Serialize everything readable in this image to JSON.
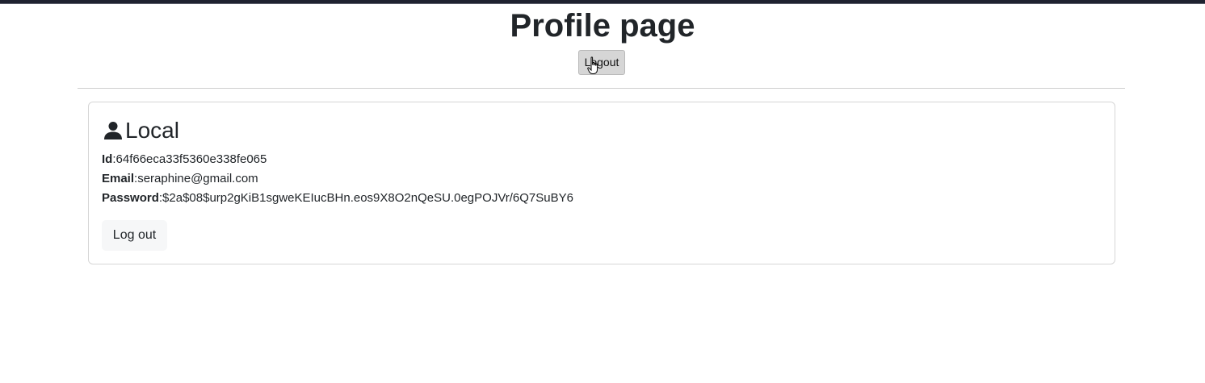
{
  "header": {
    "title": "Profile page",
    "logout_label": "Logout"
  },
  "profile_card": {
    "title": "Local",
    "icon": "user-icon",
    "fields": [
      {
        "label": "Id",
        "value": "64f66eca33f5360e338fe065"
      },
      {
        "label": "Email",
        "value": "seraphine@gmail.com"
      },
      {
        "label": "Password",
        "value": "$2a$08$urp2gKiB1sgweKEIucBHn.eos9X8O2nQeSU.0egPOJVr/6Q7SuBY6"
      }
    ],
    "logout_label": "Log out"
  }
}
